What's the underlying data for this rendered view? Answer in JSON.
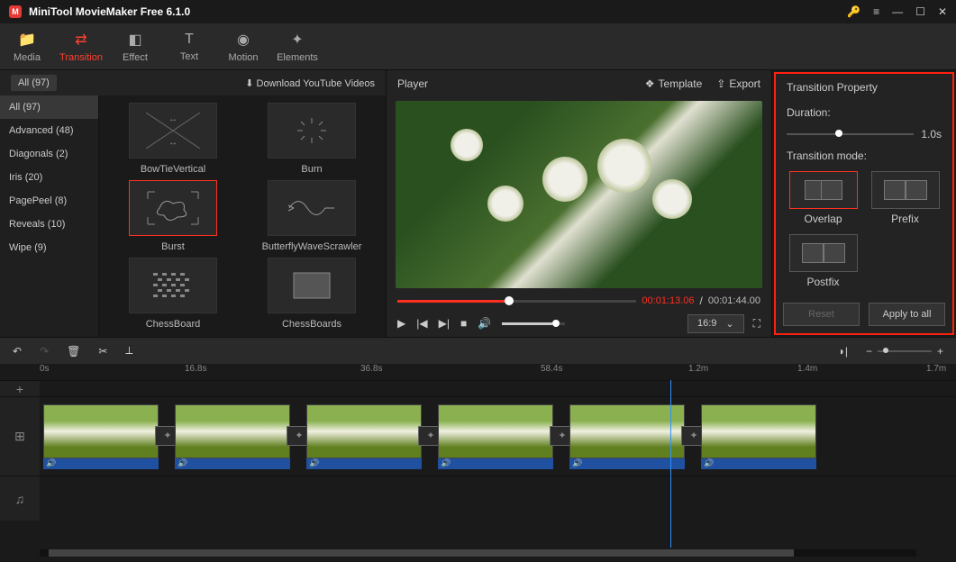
{
  "window": {
    "title": "MiniTool MovieMaker Free 6.1.0"
  },
  "tabs": [
    {
      "label": "Media",
      "icon": "📁"
    },
    {
      "label": "Transition",
      "icon": "⇄"
    },
    {
      "label": "Effect",
      "icon": "◧"
    },
    {
      "label": "Text",
      "icon": "T"
    },
    {
      "label": "Motion",
      "icon": "◉"
    },
    {
      "label": "Elements",
      "icon": "✦"
    }
  ],
  "download_label": "Download YouTube Videos",
  "categories": [
    {
      "label": "All (97)",
      "active": true
    },
    {
      "label": "Advanced (48)"
    },
    {
      "label": "Diagonals (2)"
    },
    {
      "label": "Iris (20)"
    },
    {
      "label": "PagePeel (8)"
    },
    {
      "label": "Reveals (10)"
    },
    {
      "label": "Wipe (9)"
    }
  ],
  "transitions": [
    {
      "label": "BowTieVertical"
    },
    {
      "label": "Burn"
    },
    {
      "label": "Burst",
      "selected": true
    },
    {
      "label": "ButterflyWaveScrawler"
    },
    {
      "label": "ChessBoard"
    },
    {
      "label": "ChessBoards"
    }
  ],
  "player": {
    "title": "Player",
    "template_label": "Template",
    "export_label": "Export",
    "time_current": "00:01:13.06",
    "time_total": "00:01:44.00",
    "ratio": "16:9"
  },
  "property": {
    "title": "Transition Property",
    "duration_label": "Duration:",
    "duration_value": "1.0s",
    "mode_label": "Transition mode:",
    "modes": [
      {
        "label": "Overlap",
        "selected": true
      },
      {
        "label": "Prefix"
      },
      {
        "label": "Postfix"
      }
    ],
    "reset_label": "Reset",
    "apply_label": "Apply to all"
  },
  "ruler": [
    "0s",
    "16.8s",
    "36.8s",
    "58.4s",
    "1.2m",
    "1.4m",
    "1.7m"
  ]
}
